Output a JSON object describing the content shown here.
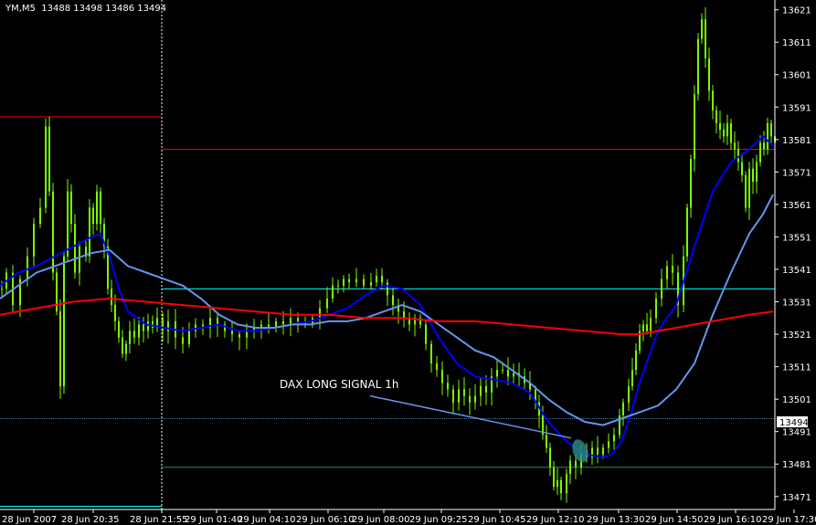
{
  "header": {
    "symbol_info": "YM,M5  13488 13498 13486 13494"
  },
  "colors": {
    "background": "#000000",
    "candle": "#7cfc00",
    "ma_fast": "#0000ff",
    "ma_slow": "#6495ed",
    "ma_long": "#ff0000",
    "hline_red": "#ff0000",
    "hline_cyan": "#00ffff",
    "hline_green": "#2e8b57",
    "hline_steel": "#4682b4",
    "axis_text": "#ffffff",
    "price_box": "#ffffff",
    "signal_line": "#6495ed",
    "signal_blob": "#2e8b8b"
  },
  "chart_data": {
    "type": "line",
    "title": "YM,M5",
    "ylim": [
      13467,
      13624
    ],
    "y_ticks": [
      13621,
      13611,
      13601,
      13591,
      13581,
      13571,
      13561,
      13551,
      13541,
      13531,
      13521,
      13511,
      13501,
      13491,
      13481,
      13471
    ],
    "x_ticks": [
      "28 Jun 2007",
      "28 Jun 20:35",
      "28 Jun 21:55",
      "29 Jun 01:40",
      "29 Jun 04:10",
      "29 Jun 06:10",
      "29 Jun 08:00",
      "29 Jun 09:25",
      "29 Jun 10:45",
      "29 Jun 12:10",
      "29 Jun 13:30",
      "29 Jun 14:50",
      "29 Jun 16:10",
      "29 Jun 17:30"
    ],
    "current_price": 13494,
    "session_separator_at": "28 Jun 21:55",
    "horizontal_levels": [
      {
        "price": 13588,
        "color": "red",
        "from": "28 Jun 2007",
        "to": "28 Jun 21:55"
      },
      {
        "price": 13578,
        "color": "red",
        "from": "28 Jun 21:55",
        "to": "29 Jun 17:30"
      },
      {
        "price": 13535,
        "color": "cyan",
        "from": "28 Jun 21:55",
        "to": "29 Jun 17:30"
      },
      {
        "price": 13495,
        "color": "steel",
        "from": "28 Jun 2007",
        "to": "29 Jun 17:30"
      },
      {
        "price": 13480,
        "color": "green",
        "from": "28 Jun 21:55",
        "to": "29 Jun 17:30"
      },
      {
        "price": 13468,
        "color": "cyan",
        "from": "28 Jun 2007",
        "to": "28 Jun 21:55"
      }
    ],
    "price_path": [
      [
        0,
        13535
      ],
      [
        5,
        13540
      ],
      [
        12,
        13530
      ],
      [
        20,
        13538
      ],
      [
        28,
        13545
      ],
      [
        35,
        13555
      ],
      [
        42,
        13560
      ],
      [
        48,
        13585
      ],
      [
        52,
        13565
      ],
      [
        56,
        13540
      ],
      [
        60,
        13528
      ],
      [
        64,
        13505
      ],
      [
        68,
        13545
      ],
      [
        72,
        13565
      ],
      [
        76,
        13555
      ],
      [
        80,
        13540
      ],
      [
        85,
        13548
      ],
      [
        92,
        13545
      ],
      [
        96,
        13560
      ],
      [
        100,
        13555
      ],
      [
        104,
        13565
      ],
      [
        108,
        13555
      ],
      [
        112,
        13548
      ],
      [
        116,
        13535
      ],
      [
        120,
        13530
      ],
      [
        124,
        13525
      ],
      [
        128,
        13520
      ],
      [
        132,
        13515
      ],
      [
        136,
        13518
      ],
      [
        140,
        13522
      ],
      [
        145,
        13520
      ],
      [
        150,
        13524
      ],
      [
        155,
        13522
      ],
      [
        160,
        13525
      ],
      [
        165,
        13523
      ],
      [
        170,
        13526
      ],
      [
        176,
        13522
      ],
      [
        182,
        13525
      ],
      [
        190,
        13520
      ],
      [
        198,
        13518
      ],
      [
        205,
        13522
      ],
      [
        212,
        13524
      ],
      [
        220,
        13523
      ],
      [
        228,
        13526
      ],
      [
        236,
        13524
      ],
      [
        244,
        13522
      ],
      [
        252,
        13521
      ],
      [
        260,
        13520
      ],
      [
        268,
        13522
      ],
      [
        276,
        13523
      ],
      [
        284,
        13524
      ],
      [
        292,
        13523
      ],
      [
        300,
        13525
      ],
      [
        308,
        13524
      ],
      [
        316,
        13526
      ],
      [
        324,
        13525
      ],
      [
        332,
        13524
      ],
      [
        340,
        13526
      ],
      [
        348,
        13529
      ],
      [
        356,
        13532
      ],
      [
        362,
        13536
      ],
      [
        368,
        13536
      ],
      [
        374,
        13538
      ],
      [
        380,
        13537
      ],
      [
        388,
        13538
      ],
      [
        396,
        13536
      ],
      [
        404,
        13537
      ],
      [
        410,
        13539
      ],
      [
        416,
        13537
      ],
      [
        422,
        13533
      ],
      [
        428,
        13530
      ],
      [
        434,
        13528
      ],
      [
        440,
        13526
      ],
      [
        446,
        13524
      ],
      [
        452,
        13526
      ],
      [
        458,
        13524
      ],
      [
        464,
        13518
      ],
      [
        470,
        13512
      ],
      [
        476,
        13510
      ],
      [
        482,
        13506
      ],
      [
        488,
        13504
      ],
      [
        494,
        13500
      ],
      [
        500,
        13504
      ],
      [
        506,
        13502
      ],
      [
        512,
        13500
      ],
      [
        518,
        13502
      ],
      [
        524,
        13505
      ],
      [
        530,
        13503
      ],
      [
        536,
        13508
      ],
      [
        542,
        13510
      ],
      [
        548,
        13510
      ],
      [
        554,
        13508
      ],
      [
        560,
        13509
      ],
      [
        566,
        13508
      ],
      [
        572,
        13506
      ],
      [
        578,
        13504
      ],
      [
        584,
        13500
      ],
      [
        588,
        13496
      ],
      [
        592,
        13490
      ],
      [
        596,
        13486
      ],
      [
        600,
        13480
      ],
      [
        604,
        13474
      ],
      [
        608,
        13476
      ],
      [
        612,
        13472
      ],
      [
        618,
        13478
      ],
      [
        622,
        13482
      ],
      [
        628,
        13480
      ],
      [
        634,
        13484
      ],
      [
        640,
        13483
      ],
      [
        646,
        13486
      ],
      [
        652,
        13484
      ],
      [
        658,
        13486
      ],
      [
        664,
        13488
      ],
      [
        670,
        13490
      ],
      [
        676,
        13496
      ],
      [
        680,
        13500
      ],
      [
        686,
        13505
      ],
      [
        690,
        13510
      ],
      [
        694,
        13516
      ],
      [
        698,
        13522
      ],
      [
        702,
        13524
      ],
      [
        706,
        13522
      ],
      [
        710,
        13526
      ],
      [
        716,
        13532
      ],
      [
        722,
        13538
      ],
      [
        728,
        13542
      ],
      [
        734,
        13540
      ],
      [
        740,
        13530
      ],
      [
        746,
        13545
      ],
      [
        750,
        13560
      ],
      [
        754,
        13575
      ],
      [
        758,
        13595
      ],
      [
        762,
        13612
      ],
      [
        766,
        13618
      ],
      [
        770,
        13606
      ],
      [
        774,
        13596
      ],
      [
        778,
        13590
      ],
      [
        782,
        13586
      ],
      [
        786,
        13584
      ],
      [
        790,
        13582
      ],
      [
        794,
        13586
      ],
      [
        798,
        13580
      ],
      [
        802,
        13578
      ],
      [
        806,
        13574
      ],
      [
        810,
        13570
      ],
      [
        814,
        13560
      ],
      [
        818,
        13572
      ],
      [
        822,
        13568
      ],
      [
        826,
        13574
      ],
      [
        830,
        13580
      ],
      [
        834,
        13578
      ],
      [
        838,
        13586
      ],
      [
        842,
        13582
      ],
      [
        846,
        13580
      ]
    ],
    "series": [
      {
        "name": "",
        "color": "#0000ff",
        "points": [
          [
            0,
            13536
          ],
          [
            20,
            13540
          ],
          [
            40,
            13542
          ],
          [
            60,
            13545
          ],
          [
            80,
            13548
          ],
          [
            100,
            13551
          ],
          [
            110,
            13552
          ],
          [
            120,
            13545
          ],
          [
            130,
            13535
          ],
          [
            140,
            13528
          ],
          [
            150,
            13526
          ],
          [
            160,
            13524
          ],
          [
            180,
            13523
          ],
          [
            200,
            13522
          ],
          [
            220,
            13523
          ],
          [
            240,
            13524
          ],
          [
            260,
            13522
          ],
          [
            280,
            13522
          ],
          [
            300,
            13523
          ],
          [
            320,
            13524
          ],
          [
            340,
            13525
          ],
          [
            360,
            13527
          ],
          [
            380,
            13529
          ],
          [
            400,
            13533
          ],
          [
            420,
            13536
          ],
          [
            440,
            13535
          ],
          [
            460,
            13530
          ],
          [
            480,
            13520
          ],
          [
            500,
            13512
          ],
          [
            520,
            13508
          ],
          [
            540,
            13507
          ],
          [
            560,
            13506
          ],
          [
            580,
            13503
          ],
          [
            600,
            13494
          ],
          [
            620,
            13488
          ],
          [
            640,
            13484
          ],
          [
            660,
            13483
          ],
          [
            670,
            13484
          ],
          [
            680,
            13488
          ],
          [
            690,
            13496
          ],
          [
            700,
            13506
          ],
          [
            710,
            13514
          ],
          [
            720,
            13522
          ],
          [
            740,
            13530
          ],
          [
            760,
            13548
          ],
          [
            780,
            13565
          ],
          [
            800,
            13574
          ],
          [
            820,
            13578
          ],
          [
            835,
            13582
          ],
          [
            846,
            13579
          ]
        ]
      },
      {
        "name": "",
        "color": "#6495ed",
        "points": [
          [
            0,
            13532
          ],
          [
            20,
            13536
          ],
          [
            40,
            13540
          ],
          [
            60,
            13542
          ],
          [
            80,
            13544
          ],
          [
            100,
            13546
          ],
          [
            120,
            13547
          ],
          [
            140,
            13542
          ],
          [
            160,
            13540
          ],
          [
            180,
            13538
          ],
          [
            200,
            13536
          ],
          [
            220,
            13532
          ],
          [
            240,
            13527
          ],
          [
            260,
            13524
          ],
          [
            280,
            13523
          ],
          [
            300,
            13523
          ],
          [
            320,
            13524
          ],
          [
            340,
            13524
          ],
          [
            360,
            13525
          ],
          [
            380,
            13525
          ],
          [
            400,
            13526
          ],
          [
            420,
            13528
          ],
          [
            440,
            13530
          ],
          [
            460,
            13528
          ],
          [
            480,
            13524
          ],
          [
            500,
            13520
          ],
          [
            520,
            13516
          ],
          [
            540,
            13514
          ],
          [
            560,
            13510
          ],
          [
            580,
            13506
          ],
          [
            600,
            13501
          ],
          [
            620,
            13497
          ],
          [
            640,
            13494
          ],
          [
            660,
            13493
          ],
          [
            680,
            13495
          ],
          [
            700,
            13497
          ],
          [
            720,
            13499
          ],
          [
            740,
            13504
          ],
          [
            760,
            13512
          ],
          [
            780,
            13527
          ],
          [
            800,
            13540
          ],
          [
            820,
            13552
          ],
          [
            835,
            13558
          ],
          [
            846,
            13564
          ]
        ]
      },
      {
        "name": "",
        "color": "#ff0000",
        "points": [
          [
            0,
            13527
          ],
          [
            40,
            13529
          ],
          [
            80,
            13531
          ],
          [
            120,
            13532
          ],
          [
            160,
            13531
          ],
          [
            200,
            13530
          ],
          [
            240,
            13529
          ],
          [
            280,
            13528
          ],
          [
            320,
            13527
          ],
          [
            360,
            13527
          ],
          [
            400,
            13526
          ],
          [
            440,
            13526
          ],
          [
            480,
            13525
          ],
          [
            520,
            13525
          ],
          [
            560,
            13524
          ],
          [
            600,
            13523
          ],
          [
            640,
            13522
          ],
          [
            680,
            13521
          ],
          [
            700,
            13521
          ],
          [
            720,
            13522
          ],
          [
            740,
            13523
          ],
          [
            760,
            13524
          ],
          [
            780,
            13525
          ],
          [
            800,
            13526
          ],
          [
            820,
            13527
          ],
          [
            846,
            13528
          ]
        ]
      }
    ],
    "annotation": {
      "text": "DAX LONG SIGNAL 1h",
      "line_from": [
        405,
        13502
      ],
      "line_to": [
        625,
        13489
      ]
    }
  }
}
